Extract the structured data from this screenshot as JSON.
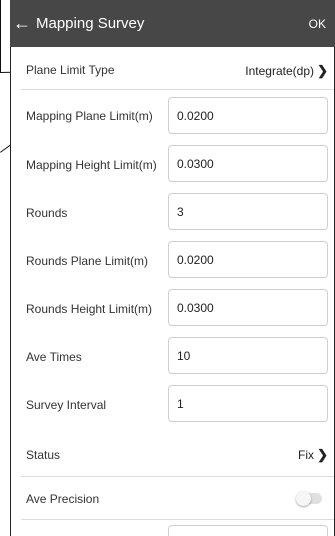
{
  "appbar": {
    "back_icon": "arrow-left-icon",
    "title": "Mapping Survey",
    "action": "OK",
    "color": "#474747"
  },
  "plane_limit_type": {
    "label": "Plane Limit Type",
    "value": "Integrate(dp)"
  },
  "fields": [
    {
      "label": "Mapping Plane Limit(m)",
      "value": "0.0200"
    },
    {
      "label": "Mapping Height Limit(m)",
      "value": "0.0300"
    },
    {
      "label": "Rounds",
      "value": "3"
    },
    {
      "label": "Rounds Plane Limit(m)",
      "value": "0.0200"
    },
    {
      "label": "Rounds Height Limit(m)",
      "value": "0.0300"
    },
    {
      "label": "Ave Times",
      "value": "10"
    },
    {
      "label": "Survey Interval",
      "value": "1"
    }
  ],
  "status": {
    "label": "Status",
    "value": "Fix"
  },
  "ave_precision": {
    "label": "Ave Precision",
    "enabled": false
  }
}
